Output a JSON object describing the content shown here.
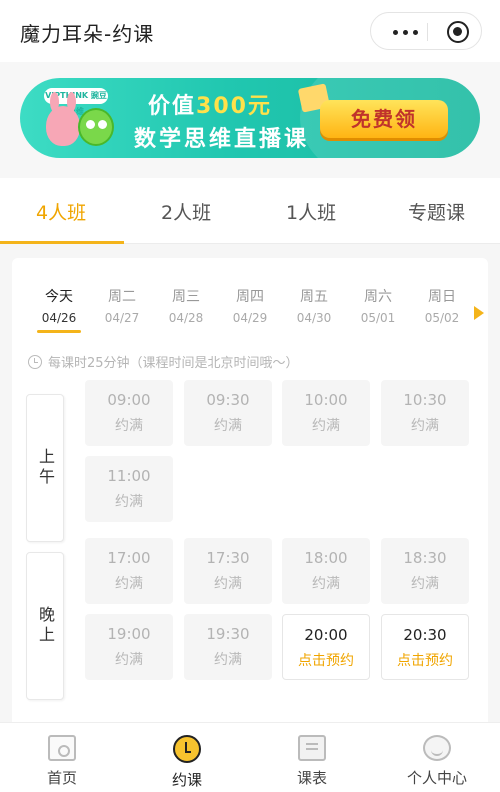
{
  "header": {
    "title": "魔力耳朵-约课",
    "more_icon": "more-dots-icon",
    "close_icon": "target-circle-icon"
  },
  "banner": {
    "brand": "VIPTHINK 豌豆思维",
    "line1_prefix": "价值",
    "line1_highlight": "300元",
    "line2": "数学思维直播课",
    "button": "免费领"
  },
  "tabs": [
    {
      "label": "4人班",
      "active": true
    },
    {
      "label": "2人班",
      "active": false
    },
    {
      "label": "1人班",
      "active": false
    },
    {
      "label": "专题课",
      "active": false
    }
  ],
  "days": [
    {
      "weekday": "今天",
      "date": "04/26",
      "active": true
    },
    {
      "weekday": "周二",
      "date": "04/27",
      "active": false
    },
    {
      "weekday": "周三",
      "date": "04/28",
      "active": false
    },
    {
      "weekday": "周四",
      "date": "04/29",
      "active": false
    },
    {
      "weekday": "周五",
      "date": "04/30",
      "active": false
    },
    {
      "weekday": "周六",
      "date": "05/01",
      "active": false
    },
    {
      "weekday": "周日",
      "date": "05/02",
      "active": false
    }
  ],
  "note": "每课时25分钟（课程时间是北京时间哦～）",
  "periods": {
    "morning": "上午",
    "evening": "晚上"
  },
  "slots": {
    "morning": [
      {
        "time": "09:00",
        "status": "约满",
        "open": false
      },
      {
        "time": "09:30",
        "status": "约满",
        "open": false
      },
      {
        "time": "10:00",
        "status": "约满",
        "open": false
      },
      {
        "time": "10:30",
        "status": "约满",
        "open": false
      },
      {
        "time": "11:00",
        "status": "约满",
        "open": false
      }
    ],
    "evening": [
      {
        "time": "17:00",
        "status": "约满",
        "open": false
      },
      {
        "time": "17:30",
        "status": "约满",
        "open": false
      },
      {
        "time": "18:00",
        "status": "约满",
        "open": false
      },
      {
        "time": "18:30",
        "status": "约满",
        "open": false
      },
      {
        "time": "19:00",
        "status": "约满",
        "open": false
      },
      {
        "time": "19:30",
        "status": "约满",
        "open": false
      },
      {
        "time": "20:00",
        "status": "点击预约",
        "open": true
      },
      {
        "time": "20:30",
        "status": "点击预约",
        "open": true
      }
    ]
  },
  "nav": [
    {
      "label": "首页",
      "icon": "home-icon",
      "active": false
    },
    {
      "label": "约课",
      "icon": "alarm-clock-icon",
      "active": true
    },
    {
      "label": "课表",
      "icon": "schedule-icon",
      "active": false
    },
    {
      "label": "个人中心",
      "icon": "user-icon",
      "active": false
    }
  ],
  "colors": {
    "accent": "#f4b41a",
    "accent_text": "#f0a500",
    "banner": "#21c7b0"
  }
}
